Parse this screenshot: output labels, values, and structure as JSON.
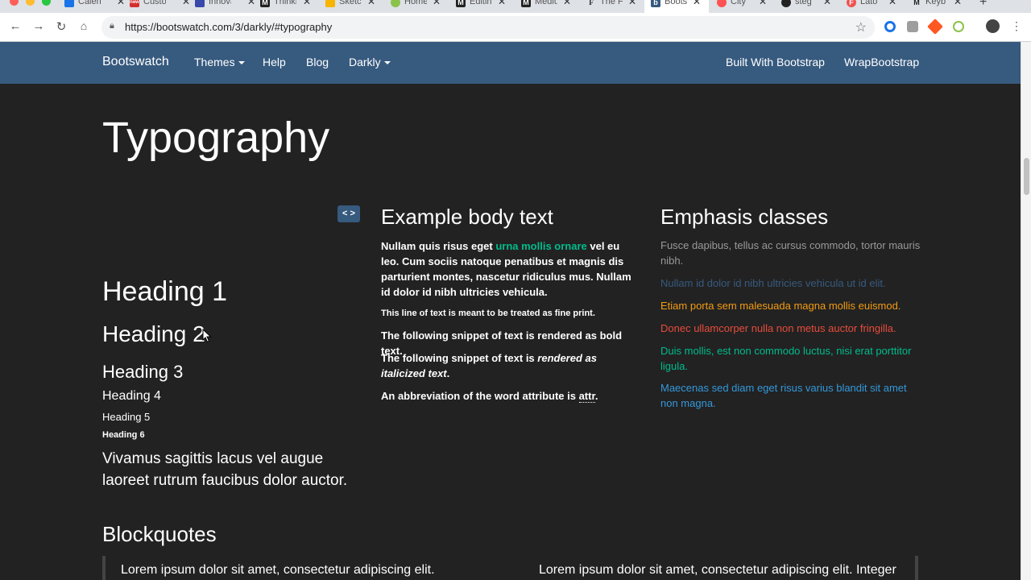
{
  "browser": {
    "tabs": [
      {
        "label": "Calendar",
        "fav_color": "#1a73e8",
        "fav_text": "",
        "active": false
      },
      {
        "label": "Custom",
        "fav_color": "#d32f2f",
        "fav_text": "new",
        "active": false
      },
      {
        "label": "Innovation",
        "fav_color": "#3949ab",
        "fav_text": "",
        "active": false
      },
      {
        "label": "Thinking",
        "fav_color": "#222222",
        "fav_text": "M",
        "active": false
      },
      {
        "label": "Sketch",
        "fav_color": "#f7b500",
        "fav_text": "",
        "active": false
      },
      {
        "label": "Home",
        "fav_color": "#8bc34a",
        "fav_text": "",
        "active": false
      },
      {
        "label": "Editing",
        "fav_color": "#222222",
        "fav_text": "M",
        "active": false
      },
      {
        "label": "Medium",
        "fav_color": "#222222",
        "fav_text": "M",
        "active": false
      },
      {
        "label": "The F",
        "fav_color": "#ffffff",
        "fav_text": "F",
        "active": false
      },
      {
        "label": "Bootswatch",
        "fav_color": "#375a7f",
        "fav_text": "b",
        "active": true
      },
      {
        "label": "City",
        "fav_color": "#ff5252",
        "fav_text": "",
        "active": false
      },
      {
        "label": "steg",
        "fav_color": "#222222",
        "fav_text": "",
        "active": false
      },
      {
        "label": "Lato",
        "fav_color": "#ef5350",
        "fav_text": "F",
        "active": false
      },
      {
        "label": "Keyb",
        "fav_color": "#ffffff",
        "fav_text": "M",
        "active": false
      }
    ],
    "url": "https://bootswatch.com/3/darkly/#typography"
  },
  "navbar": {
    "brand": "Bootswatch",
    "themes": "Themes",
    "help": "Help",
    "blog": "Blog",
    "darkly": "Darkly",
    "built_with": "Built With Bootstrap",
    "wrap": "WrapBootstrap"
  },
  "page": {
    "title": "Typography",
    "code_toggle": "< >",
    "headings": [
      "Heading 1",
      "Heading 2",
      "Heading 3",
      "Heading 4",
      "Heading 5",
      "Heading 6"
    ],
    "lead_line1": "Vivamus sagittis lacus vel augue",
    "lead_line2": "laoreet rutrum faucibus dolor auctor.",
    "body_title": "Example body text",
    "body_pre": "Nullam quis risus eget ",
    "body_link": "urna mollis ornare",
    "body_post": " vel eu leo. Cum sociis natoque penatibus et magnis dis parturient montes, nascetur ridiculus mus. Nullam id dolor id nibh ultricies vehicula.",
    "fine_print": "This line of text is meant to be treated as fine print.",
    "bold_pre": "The following snippet of text is ",
    "bold_text": "rendered as bold text",
    "bold_post": ".",
    "italic_pre": "The following snippet of text is ",
    "italic_text": "rendered as italicized text",
    "italic_post": ".",
    "abbr_pre": "An abbreviation of the word attribute is ",
    "abbr_text": "attr",
    "abbr_post": ".",
    "emphasis_title": "Emphasis classes",
    "emphasis": [
      {
        "text": "Fusce dapibus, tellus ac cursus commodo, tortor mauris nibh.",
        "color": "#999999"
      },
      {
        "text": "Nullam id dolor id nibh ultricies vehicula ut id elit.",
        "color": "#375a7f"
      },
      {
        "text": "Etiam porta sem malesuada magna mollis euismod.",
        "color": "#f39c12"
      },
      {
        "text": "Donec ullamcorper nulla non metus auctor fringilla.",
        "color": "#e74c3c"
      },
      {
        "text": "Duis mollis, est non commodo luctus, nisi erat porttitor ligula.",
        "color": "#00bc8c"
      },
      {
        "text": "Maecenas sed diam eget risus varius blandit sit amet non magna.",
        "color": "#3498db"
      }
    ],
    "blockquotes_title": "Blockquotes",
    "quote_left": "Lorem ipsum dolor sit amet, consectetur adipiscing elit.",
    "quote_right": "Lorem ipsum dolor sit amet, consectetur adipiscing elit. Integer"
  },
  "colors": {
    "navbar": "#375a7f",
    "background": "#222222",
    "success": "#00bc8c"
  }
}
